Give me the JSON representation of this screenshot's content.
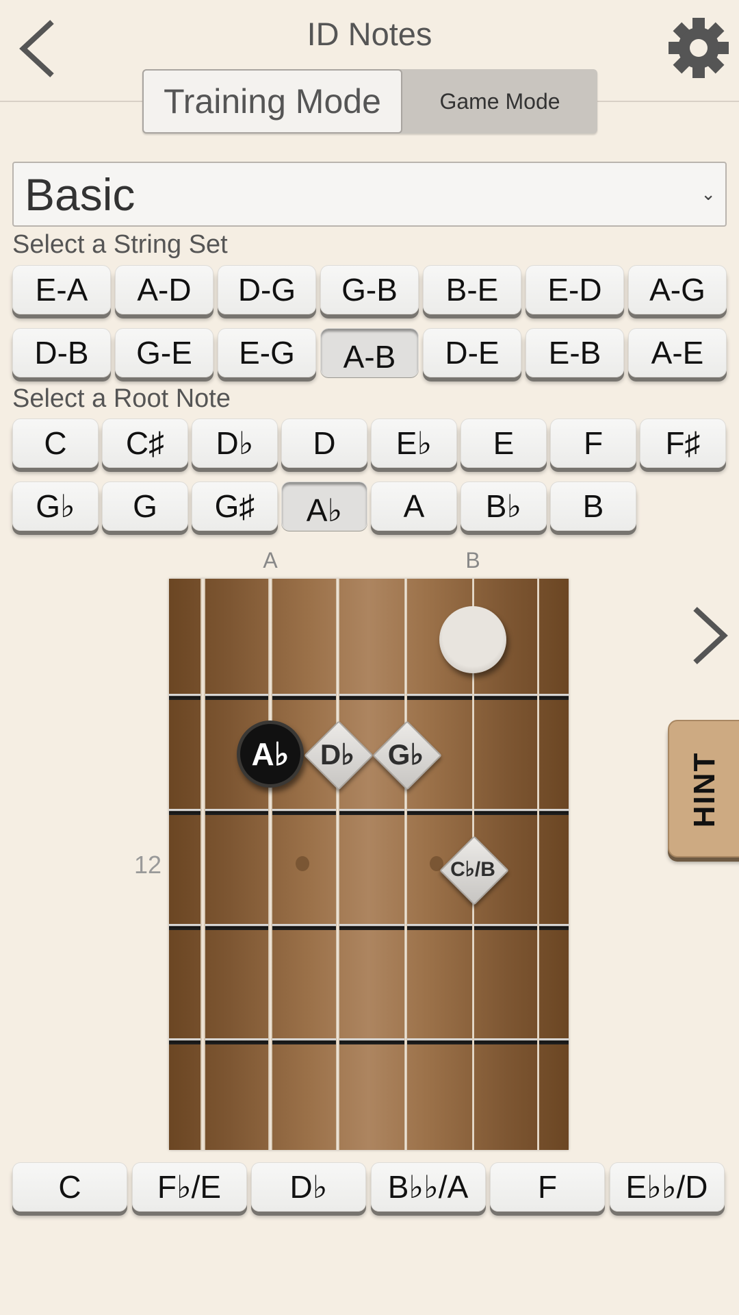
{
  "header": {
    "title": "ID Notes",
    "back_icon": "chevron-left-icon",
    "settings_icon": "gear-icon"
  },
  "mode_toggle": {
    "options": [
      {
        "label": "Training Mode",
        "selected": true
      },
      {
        "label": "Game Mode",
        "selected": false
      }
    ]
  },
  "level_select": {
    "value": "Basic",
    "chevron": "⌄"
  },
  "string_set": {
    "label": "Select a String Set",
    "options": [
      "E-A",
      "A-D",
      "D-G",
      "G-B",
      "B-E",
      "E-D",
      "A-G",
      "D-B",
      "G-E",
      "E-G",
      "A-B",
      "D-E",
      "E-B",
      "A-E"
    ],
    "selected": "A-B"
  },
  "root_note": {
    "label": "Select a Root Note",
    "options": [
      "C",
      "C♯",
      "D♭",
      "D",
      "E♭",
      "E",
      "F",
      "F♯",
      "G♭",
      "G",
      "G♯",
      "A♭",
      "A",
      "B♭",
      "B"
    ],
    "selected": "A♭"
  },
  "fretboard": {
    "string_labels": [
      {
        "string_index": 1,
        "label": "A"
      },
      {
        "string_index": 4,
        "label": "B"
      }
    ],
    "fret_number_label": "12",
    "markers": [
      {
        "type": "target",
        "string_index": 4,
        "fret_row": 0,
        "label": ""
      },
      {
        "type": "root",
        "string_index": 1,
        "fret_row": 1,
        "label": "A♭"
      },
      {
        "type": "interval",
        "string_index": 2,
        "fret_row": 1,
        "label": "D♭"
      },
      {
        "type": "interval",
        "string_index": 3,
        "fret_row": 1,
        "label": "G♭"
      },
      {
        "type": "interval",
        "string_index": 4,
        "fret_row": 2,
        "label": "C♭/B"
      }
    ]
  },
  "next_icon": "chevron-right-icon",
  "hint": {
    "label": "HINT"
  },
  "answers": [
    "C",
    "F♭/E",
    "D♭",
    "B♭♭/A",
    "F",
    "E♭♭/D"
  ],
  "colors": {
    "background": "#f5eee3",
    "hint_tab": "#cdaa82",
    "fretboard_dark": "#6b4623",
    "fretboard_light": "#ad8560"
  }
}
